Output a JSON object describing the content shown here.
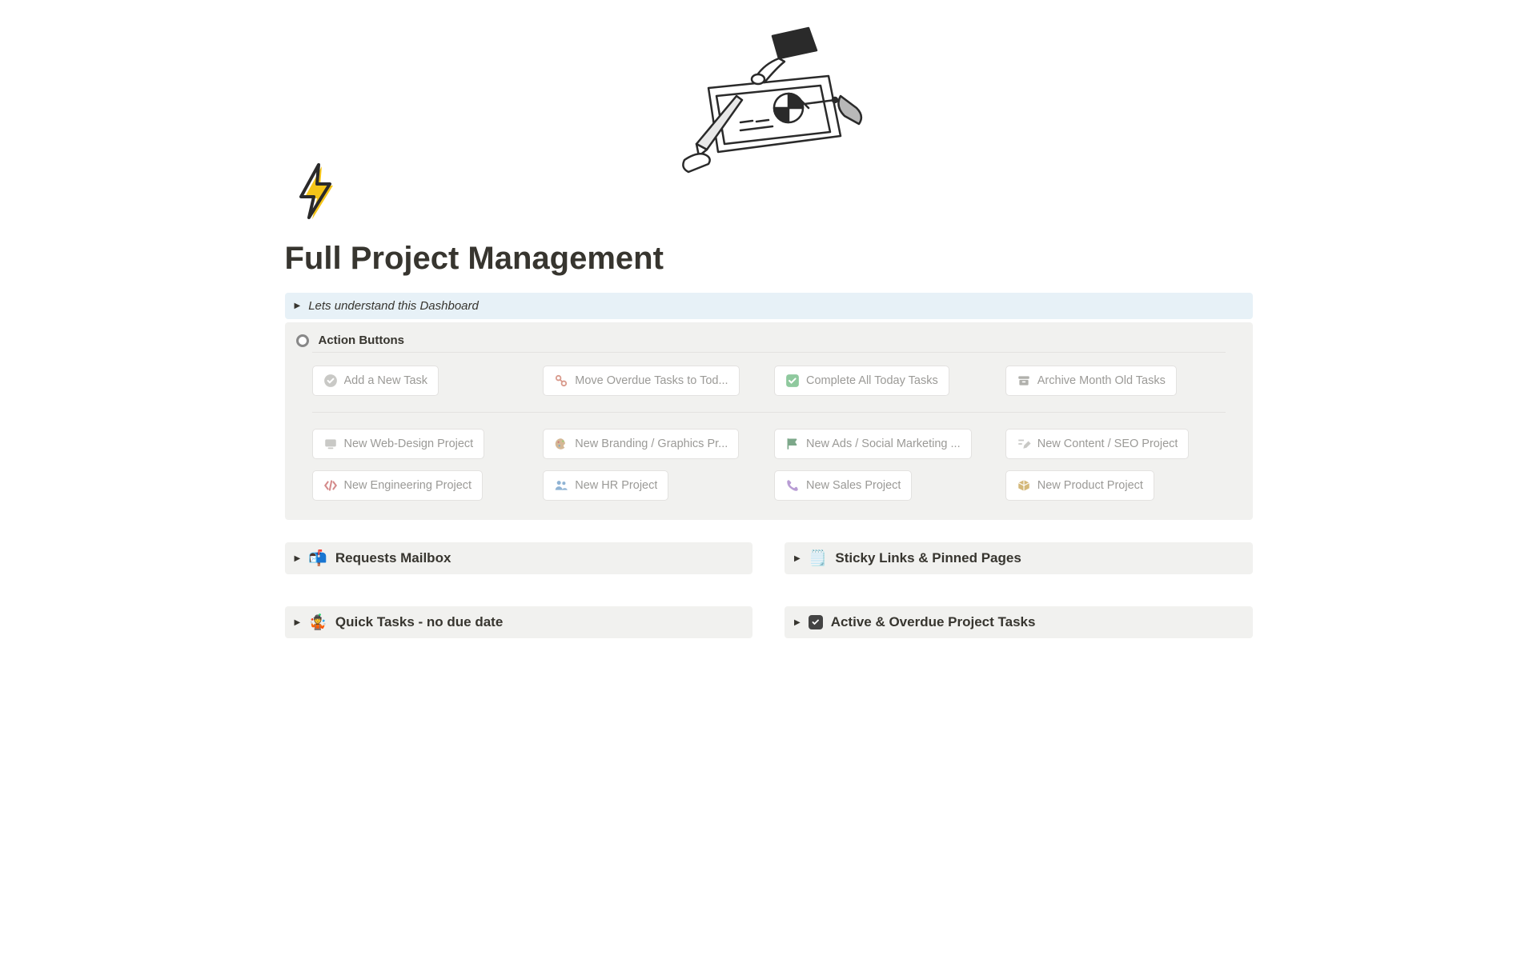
{
  "page": {
    "title": "Full Project Management"
  },
  "callout": {
    "text": "Lets understand this Dashboard"
  },
  "actions": {
    "title": "Action Buttons",
    "row1": [
      {
        "label": "Add a New Task"
      },
      {
        "label": "Move Overdue Tasks to Tod..."
      },
      {
        "label": "Complete All Today Tasks"
      },
      {
        "label": "Archive Month Old Tasks"
      }
    ],
    "row2": [
      {
        "label": "New Web-Design Project"
      },
      {
        "label": "New Branding / Graphics Pr..."
      },
      {
        "label": "New Ads / Social Marketing ..."
      },
      {
        "label": "New Content / SEO Project"
      }
    ],
    "row3": [
      {
        "label": "New Engineering Project"
      },
      {
        "label": "New HR Project"
      },
      {
        "label": "New Sales Project"
      },
      {
        "label": "New Product Project"
      }
    ]
  },
  "sections": {
    "requests": {
      "title": "Requests Mailbox"
    },
    "sticky": {
      "title": "Sticky Links & Pinned Pages"
    },
    "quick": {
      "title": "Quick Tasks - no due date"
    },
    "active": {
      "title": "Active & Overdue Project Tasks"
    }
  }
}
